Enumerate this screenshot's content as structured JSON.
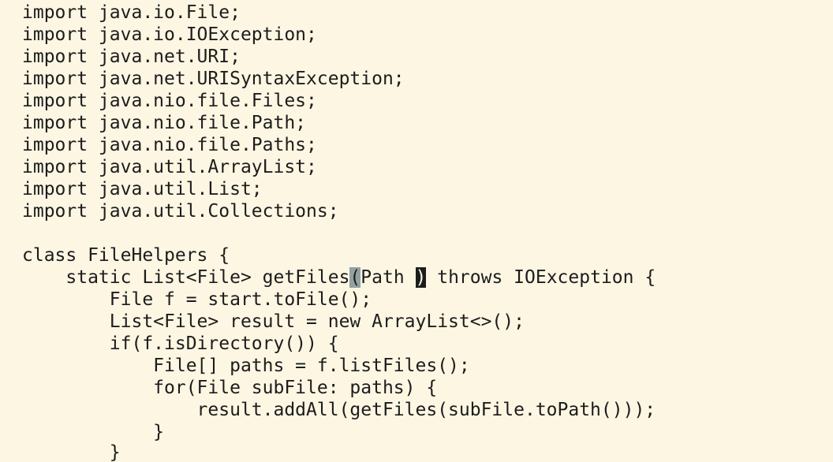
{
  "editor": {
    "lines": [
      {
        "text": "import java.io.File;"
      },
      {
        "text": "import java.io.IOException;"
      },
      {
        "text": "import java.net.URI;"
      },
      {
        "text": "import java.net.URISyntaxException;"
      },
      {
        "text": "import java.nio.file.Files;"
      },
      {
        "text": "import java.nio.file.Path;"
      },
      {
        "text": "import java.nio.file.Paths;"
      },
      {
        "text": "import java.util.ArrayList;"
      },
      {
        "text": "import java.util.List;"
      },
      {
        "text": "import java.util.Collections;"
      },
      {
        "text": ""
      },
      {
        "text": "class FileHelpers {"
      },
      {
        "before": "    static List<File> getFiles",
        "match": "(",
        "middle": "Path ",
        "cursor": ")",
        "after": " throws IOException {"
      },
      {
        "text": "        File f = start.toFile();"
      },
      {
        "text": "        List<File> result = new ArrayList<>();"
      },
      {
        "text": "        if(f.isDirectory()) {"
      },
      {
        "text": "            File[] paths = f.listFiles();"
      },
      {
        "text": "            for(File subFile: paths) {"
      },
      {
        "text": "                result.addAll(getFiles(subFile.toPath()));"
      },
      {
        "text": "            }"
      },
      {
        "text": "        }"
      }
    ]
  },
  "colors": {
    "background": "#fdf6e3",
    "text": "#1c1c1c",
    "bracket_match_highlight": "#93a1a1",
    "cursor": "#1c1c1c"
  }
}
